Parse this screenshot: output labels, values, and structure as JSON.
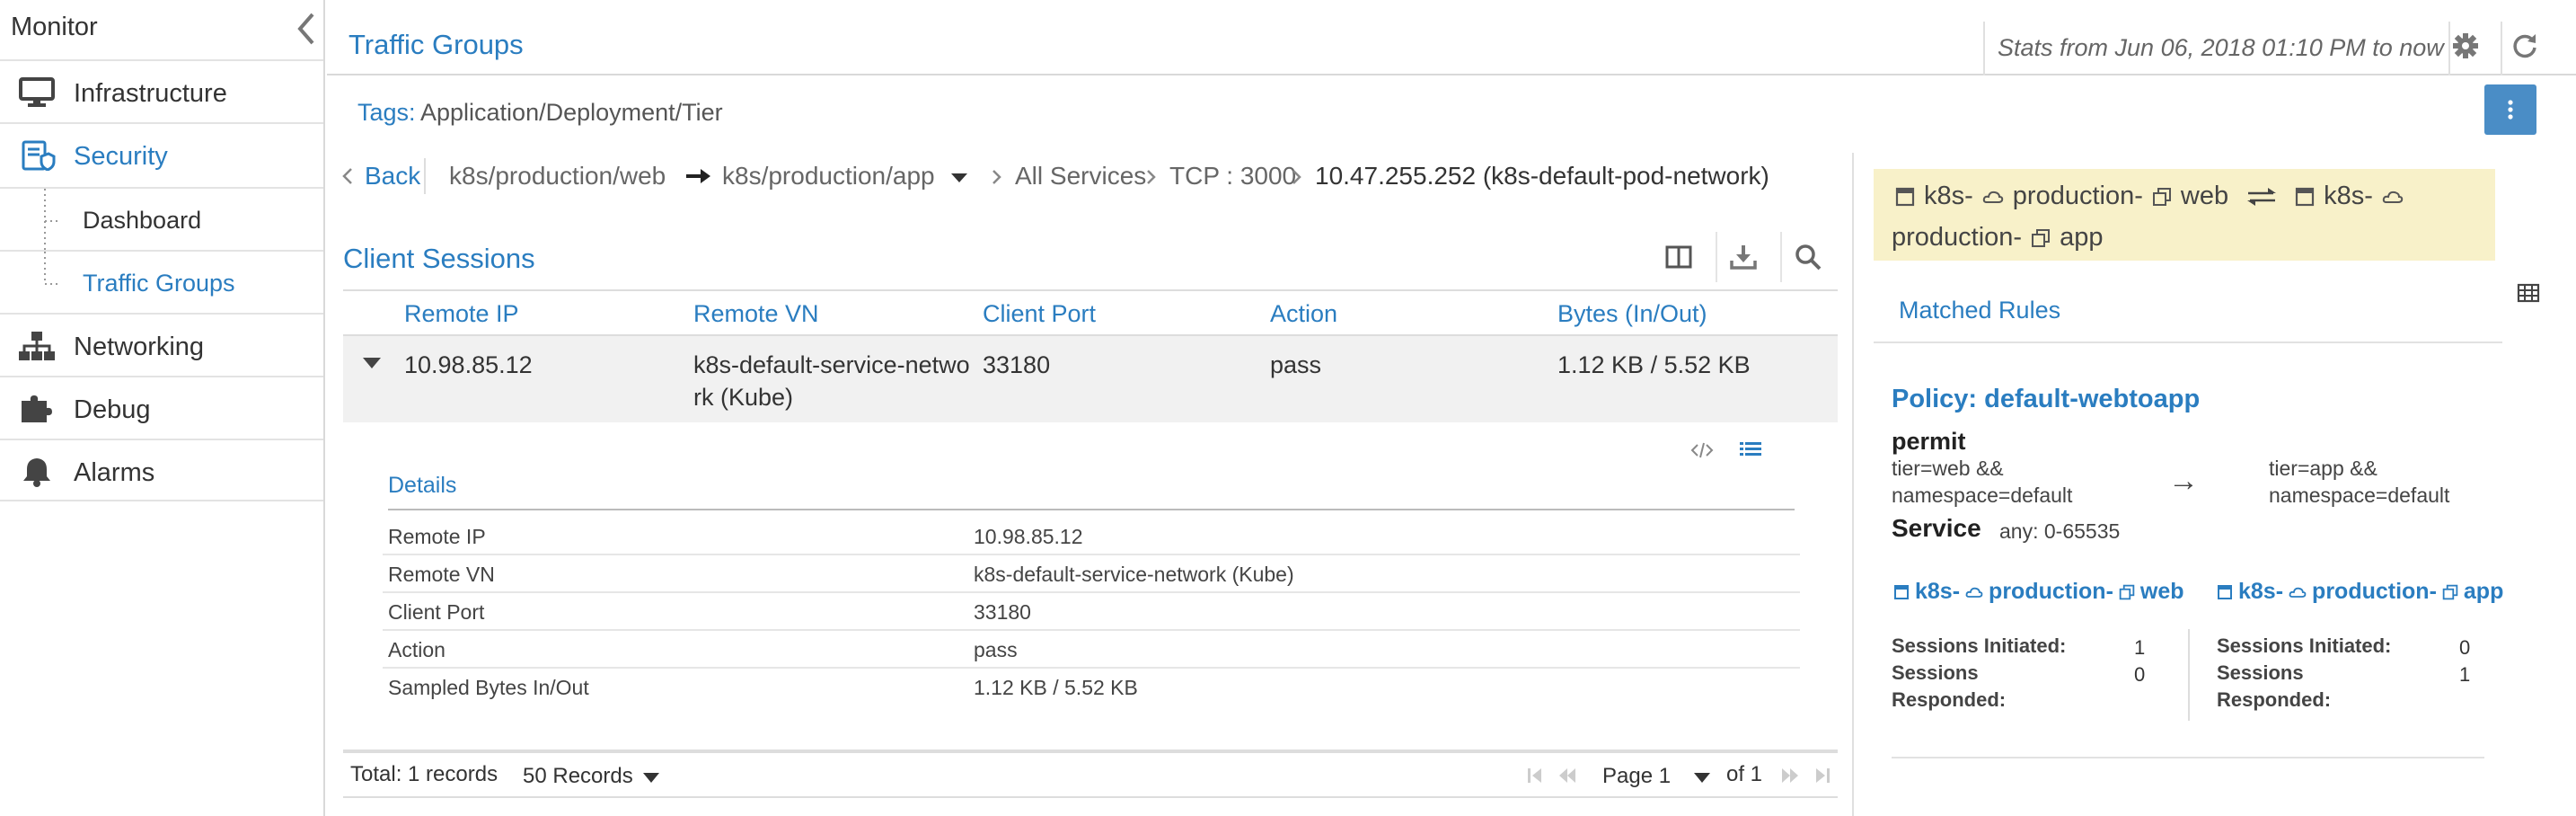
{
  "sidebar": {
    "title": "Monitor",
    "items": [
      {
        "label": "Infrastructure",
        "icon": "monitor-icon"
      },
      {
        "label": "Security",
        "icon": "security-icon",
        "active": true
      },
      {
        "label": "Networking",
        "icon": "network-icon"
      },
      {
        "label": "Debug",
        "icon": "puzzle-icon"
      },
      {
        "label": "Alarms",
        "icon": "bell-icon"
      }
    ],
    "sub_items": [
      {
        "label": "Dashboard"
      },
      {
        "label": "Traffic Groups",
        "active": true
      }
    ]
  },
  "header": {
    "title": "Traffic Groups",
    "stats": "Stats from Jun 06, 2018 01:10 PM to now"
  },
  "tags": {
    "key": "Tags:",
    "value": "Application/Deployment/Tier"
  },
  "breadcrumb": {
    "back": "Back",
    "source": "k8s/production/web",
    "destination": "k8s/production/app",
    "services": "All Services",
    "port": "TCP : 3000",
    "address": "10.47.255.252 (k8s-default-pod-network)"
  },
  "client_sessions": {
    "title": "Client Sessions",
    "columns": [
      "Remote IP",
      "Remote VN",
      "Client Port",
      "Action",
      "Bytes (In/Out)"
    ],
    "rows": [
      {
        "remote_ip": "10.98.85.12",
        "remote_vn_line1": "k8s-default-service-netwo",
        "remote_vn_line2": "rk (Kube)",
        "client_port": "33180",
        "action": "pass",
        "bytes": "1.12 KB / 5.52 KB"
      }
    ],
    "details": {
      "title": "Details",
      "fields": [
        {
          "key": "Remote IP",
          "value": "10.98.85.12"
        },
        {
          "key": "Remote VN",
          "value": "k8s-default-service-network (Kube)"
        },
        {
          "key": "Client Port",
          "value": "33180"
        },
        {
          "key": "Action",
          "value": "pass"
        },
        {
          "key": "Sampled Bytes In/Out",
          "value": "1.12 KB / 5.52 KB"
        }
      ]
    }
  },
  "pager": {
    "total": "Total: 1 records",
    "page_size": "50 Records",
    "page": "Page 1",
    "of": "of 1"
  },
  "right_panel": {
    "k8s": "k8s-",
    "production": "production-",
    "web": "web",
    "app": "app",
    "matched_rules": "Matched Rules",
    "policy": "Policy: default-webtoapp",
    "permit": "permit",
    "src_line1": "tier=web &&",
    "src_line2": "namespace=default",
    "arrow": "→",
    "dst_line1": "tier=app &&",
    "dst_line2": "namespace=default",
    "service_label": "Service",
    "service_value": "any: 0-65535",
    "left_stats": {
      "initiated_label": "Sessions Initiated:",
      "initiated": "1",
      "responded_line1": "Sessions",
      "responded_line2": "Responded:",
      "responded": "0"
    },
    "right_stats": {
      "initiated_label": "Sessions Initiated:",
      "initiated": "0",
      "responded_line1": "Sessions",
      "responded_line2": "Responded:",
      "responded": "1"
    }
  },
  "colors": {
    "accent": "#2a7dc0",
    "button": "#4a8dc6",
    "highlight": "#f8f1c9"
  }
}
